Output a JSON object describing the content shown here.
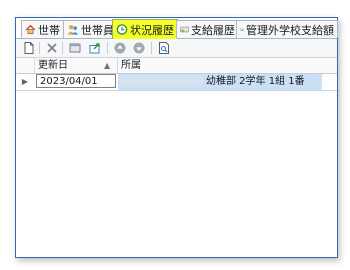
{
  "tabs": [
    {
      "label": "世帯",
      "icon": "home-icon",
      "active": false
    },
    {
      "label": "世帯員",
      "icon": "people-icon",
      "active": false
    },
    {
      "label": "状況履歴",
      "icon": "clock-icon",
      "active": true
    },
    {
      "label": "支給履歴",
      "icon": "payment-icon",
      "active": false
    },
    {
      "label": "管理外学校支給額",
      "icon": "school-payment-icon",
      "active": false
    }
  ],
  "toolbar": {
    "icons": [
      "new-document-icon",
      "delete-icon",
      "copy-icon",
      "export-icon",
      "move-up-icon",
      "move-down-icon",
      "preview-icon"
    ]
  },
  "grid": {
    "columns": [
      "更新日",
      "所属"
    ],
    "sort_indicator": "▲",
    "rows": [
      {
        "date": "2023/04/01",
        "affiliation": "幼稚部 2学年 1組 1番"
      }
    ]
  },
  "colors": {
    "active_tab": "#f2ff2a",
    "selected_row": "#c9e0f7",
    "panel_border": "#2f69b7"
  }
}
